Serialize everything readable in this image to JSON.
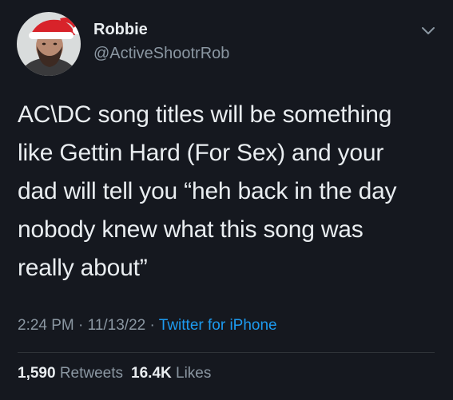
{
  "author": {
    "display_name": "Robbie",
    "handle": "@ActiveShootrRob"
  },
  "tweet": {
    "lines": [
      "AC\\DC song titles will be something",
      "like Gettin Hard (For Sex) and your",
      "dad will tell you “heh back in the day",
      "nobody knew what this song was",
      "really about”"
    ]
  },
  "meta": {
    "time": "2:24 PM",
    "date": "11/13/22",
    "separator": "·",
    "source": "Twitter for iPhone"
  },
  "stats": {
    "retweets_count": "1,590",
    "retweets_label": "Retweets",
    "likes_count": "16.4K",
    "likes_label": "Likes"
  },
  "icons": {
    "menu": "chevron-down-icon",
    "avatar": "avatar"
  },
  "colors": {
    "background": "#15181f",
    "text": "#e9edf0",
    "secondary": "#8b97a2",
    "link": "#1d9bf0"
  }
}
